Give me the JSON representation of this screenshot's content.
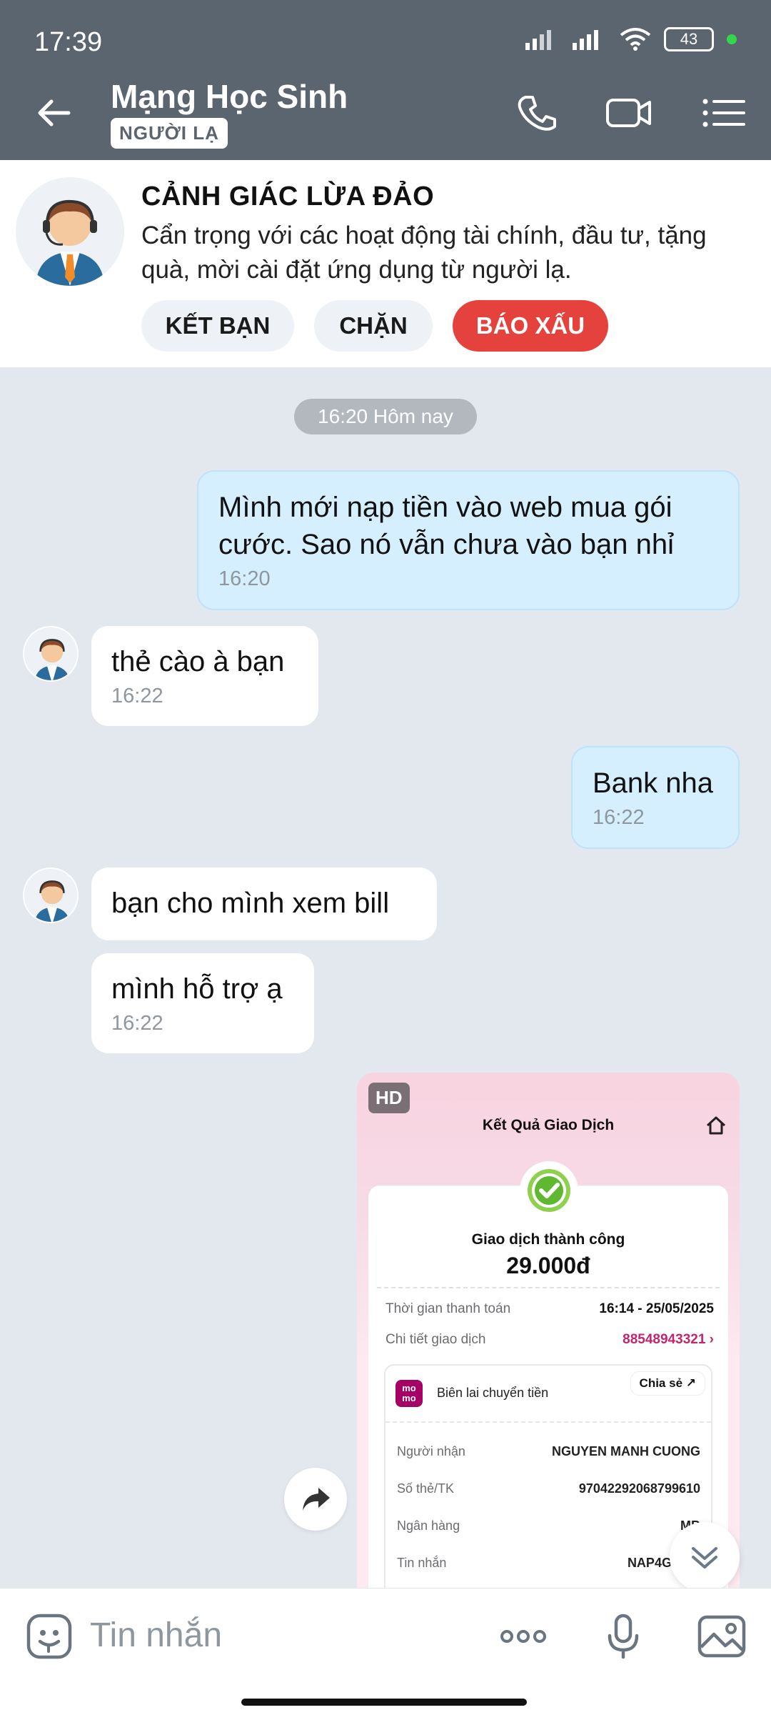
{
  "status_bar": {
    "time": "17:39",
    "battery": "43"
  },
  "header": {
    "title": "Mạng Học Sinh",
    "badge": "NGƯỜI LẠ"
  },
  "warning": {
    "title": "CẢNH GIÁC LỪA ĐẢO",
    "text": "Cẩn trọng với các hoạt động tài chính, đầu tư, tặng quà, mời cài đặt ứng dụng từ người lạ.",
    "buttons": {
      "add_friend": "KẾT BẠN",
      "block": "CHẶN",
      "report": "BÁO XẤU"
    }
  },
  "chat": {
    "timestamp": "16:20 Hôm nay",
    "messages": [
      {
        "text": "Mình mới nạp tiền vào web mua gói cước. Sao nó vẫn chưa vào bạn nhỉ",
        "time": "16:20"
      },
      {
        "text": "thẻ cào à bạn",
        "time": "16:22"
      },
      {
        "text": "Bank nha",
        "time": "16:22"
      },
      {
        "text": "bạn cho mình xem bill",
        "time": ""
      },
      {
        "text": "mình hỗ trợ ạ",
        "time": "16:22"
      }
    ],
    "image": {
      "badge": "HD",
      "title": "Kết Quả Giao Dịch",
      "status": "Giao dịch thành công",
      "amount": "29.000đ",
      "pay_time_label": "Thời gian thanh toán",
      "pay_time_value": "16:14 - 25/05/2025",
      "detail_label": "Chi tiết giao dịch",
      "detail_value": "88548943321 ›",
      "momo_logo": "mo mo",
      "receipt_label": "Biên lai chuyển tiền",
      "share": "Chia sẻ",
      "rows": [
        {
          "label": "Người nhận",
          "value": "NGUYEN MANH CUONG"
        },
        {
          "label": "Số thẻ/TK",
          "value": "97042292068799610"
        },
        {
          "label": "Ngân hàng",
          "value": "MB"
        },
        {
          "label": "Tin nhắn",
          "value": "NAP4G5357"
        }
      ]
    }
  },
  "input": {
    "placeholder": "Tin nhắn"
  }
}
